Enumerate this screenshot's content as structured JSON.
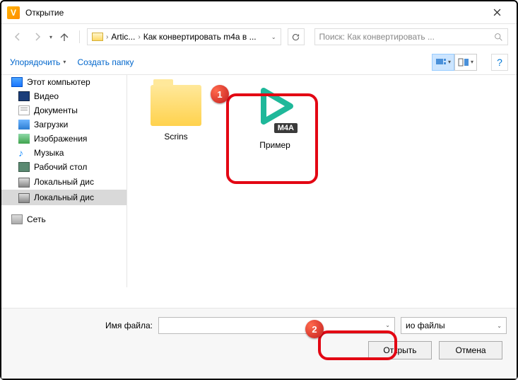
{
  "titlebar": {
    "title": "Открытие"
  },
  "nav": {
    "path_seg1": "Artic...",
    "path_seg2": "Как конвертировать m4a в ...",
    "search_placeholder": "Поиск: Как конвертировать ..."
  },
  "toolbar": {
    "organize": "Упорядочить",
    "new_folder": "Создать папку"
  },
  "sidebar": {
    "computer": "Этот компьютер",
    "items": [
      "Видео",
      "Документы",
      "Загрузки",
      "Изображения",
      "Музыка",
      "Рабочий стол",
      "Локальный дис",
      "Локальный дис"
    ],
    "network": "Сеть"
  },
  "content": {
    "folder_name": "Scrins",
    "file_name": "Пример",
    "file_badge": "M4A"
  },
  "footer": {
    "filename_label": "Имя файла:",
    "filter_label": "ио файлы",
    "open": "Открыть",
    "cancel": "Отмена"
  },
  "annotations": {
    "badge1": "1",
    "badge2": "2"
  }
}
